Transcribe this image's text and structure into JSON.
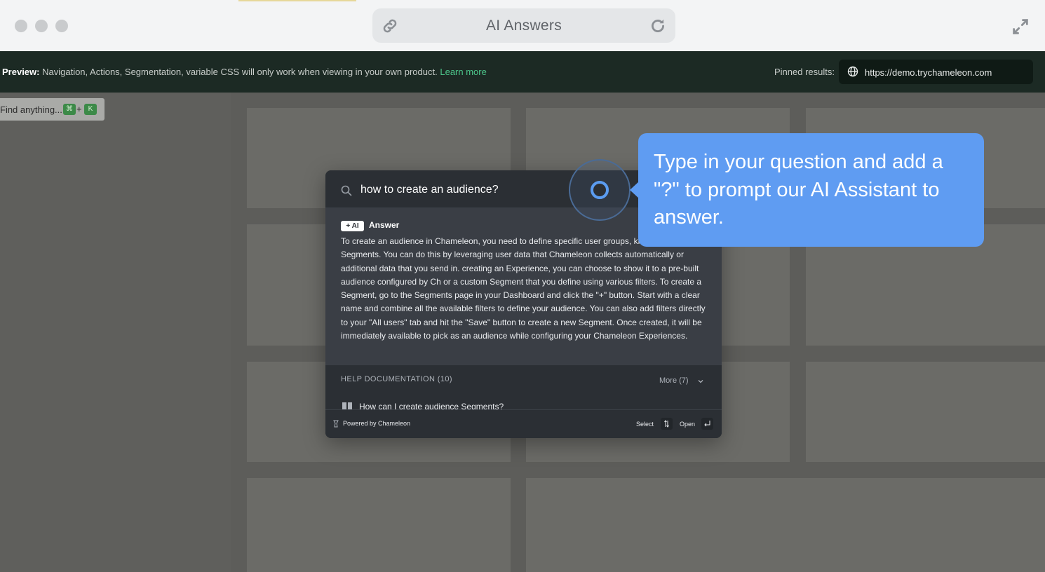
{
  "browser": {
    "title": "AI Answers",
    "icons": {
      "link": "link-icon",
      "reload": "reload-icon",
      "expand": "expand-icon"
    },
    "colors": {
      "chrome": "#f3f4f5",
      "urlbar": "#e4e6e8"
    }
  },
  "preview_bar": {
    "prefix": "Preview:",
    "message": "Navigation, Actions, Segmentation, variable CSS will only work when viewing in your own product.",
    "learn_more": "Learn more",
    "pinned_label": "Pinned results:",
    "pinned_url": "https://demo.trychameleon.com",
    "colors": {
      "background": "#1c2a24",
      "link": "#4cc58a"
    }
  },
  "launcher": {
    "placeholder": "Find anything...",
    "key1": "⌘",
    "plus": "+",
    "key2": "K"
  },
  "search_modal": {
    "query": "how to create an audience?",
    "ai_badge": "+ AI",
    "answer_label": "Answer",
    "answer_text": "To create an audience in Chameleon, you need to define specific user groups, known as Segments. You can do this by leveraging user data that Chameleon collects automatically or additional data that you send in. creating an Experience, you can choose to show it to a pre-built audience configured by Ch or a custom Segment that you define using various filters. To create a Segment, go to the Segments page in your Dashboard and click the \"+\" button. Start with a clear name and combine all the available filters to define your audience. You can also add filters directly to your \"All users\" tab and hit the \"Save\" button to create a new Segment. Once created, it will be immediately available to pick as an audience while configuring your Chameleon Experiences.",
    "help_title": "HELP DOCUMENTATION (10)",
    "more_label": "More (7)",
    "help_items": [
      {
        "title": "How can I create audience Segments?"
      }
    ],
    "footer": {
      "powered_by": "Powered by Chameleon",
      "select_label": "Select",
      "open_label": "Open"
    }
  },
  "tooltip": {
    "text": "Type in your question and add a \"?\" to prompt our AI Assistant to answer.",
    "color": "#5f9cf2"
  }
}
